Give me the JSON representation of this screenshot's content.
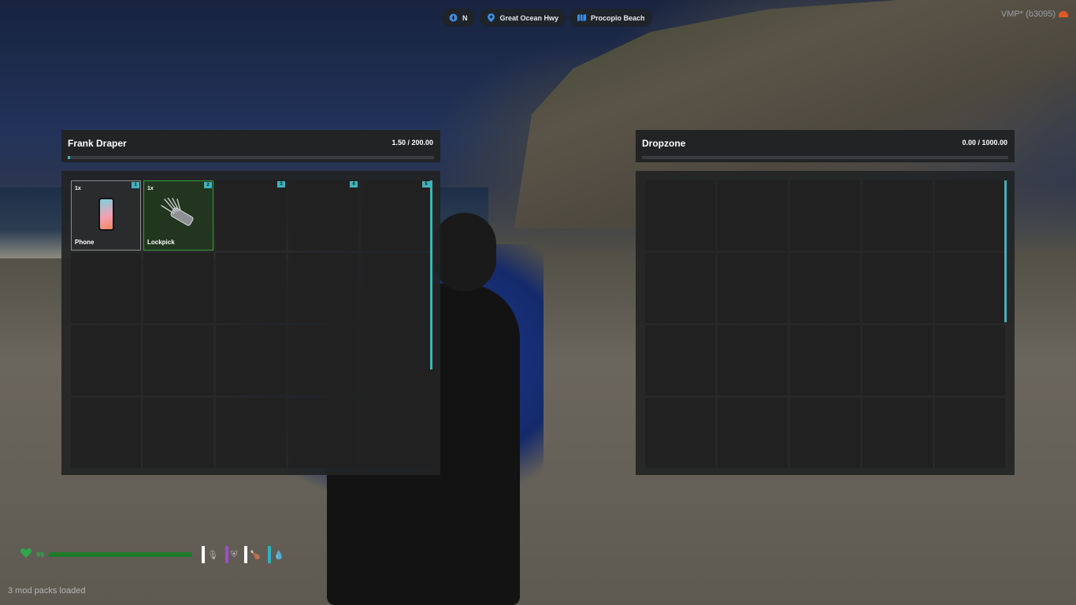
{
  "topbar": {
    "direction": {
      "icon": "compass-icon",
      "label": "N"
    },
    "street": {
      "icon": "location-pin-icon",
      "label": "Great Ocean Hwy"
    },
    "zone": {
      "icon": "map-icon",
      "label": "Procopio Beach"
    }
  },
  "watermark": {
    "text": "VMP* (b3095)",
    "icon": "fivem-logo-icon"
  },
  "player_inventory": {
    "name": "Frank Draper",
    "weight": "1.50 / 200.00",
    "weight_fraction": 0.0075,
    "slot_count": 20,
    "slots": [
      {
        "num": "1",
        "qty": "1x",
        "label": "Phone",
        "icon": "phone-icon"
      },
      {
        "num": "2",
        "qty": "1x",
        "label": "Lockpick",
        "icon": "lockpick-icon",
        "highlighted": true
      },
      {
        "num": "3"
      },
      {
        "num": "4"
      },
      {
        "num": "5"
      }
    ]
  },
  "dropzone": {
    "name": "Dropzone",
    "weight": "0.00 / 1000.00",
    "weight_fraction": 0,
    "slot_count": 20
  },
  "hud": {
    "health_value": "99",
    "health_fraction": 0.99,
    "health_color": "#2ea84a",
    "stats": [
      {
        "icon": "microphone-icon",
        "color": "#ffffff"
      },
      {
        "icon": "armor-icon",
        "color": "#9b4fc8"
      },
      {
        "icon": "hunger-icon",
        "color": "#ffffff"
      },
      {
        "icon": "thirst-icon",
        "color": "#2bb3c0"
      }
    ]
  },
  "footer": {
    "modpacks": "3 mod packs loaded"
  },
  "colors": {
    "accent": "#3fb3bd",
    "panel": "#222325",
    "slot": "#212121"
  }
}
